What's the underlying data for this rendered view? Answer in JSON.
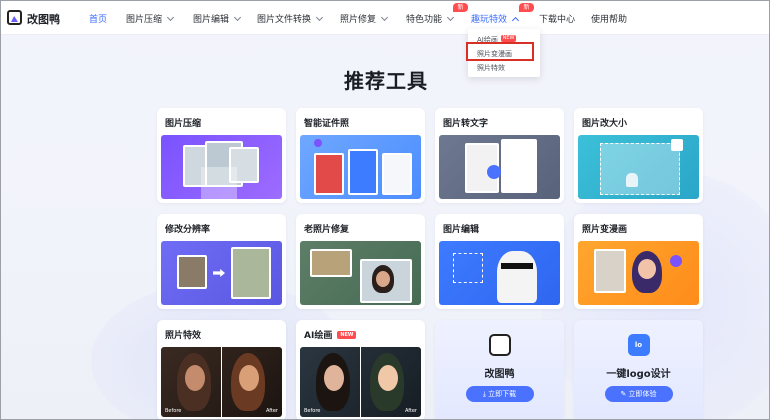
{
  "brand": {
    "name": "改图鸭"
  },
  "nav": {
    "items": [
      {
        "label": "首页",
        "active": true
      },
      {
        "label": "图片压缩",
        "dropdown": true
      },
      {
        "label": "图片编辑",
        "dropdown": true
      },
      {
        "label": "图片文件转换",
        "dropdown": true
      },
      {
        "label": "照片修复",
        "dropdown": true
      },
      {
        "label": "特色功能",
        "dropdown": true,
        "badge": "新"
      },
      {
        "label": "趣玩特效",
        "dropdown": true,
        "badge": "新",
        "open": true
      },
      {
        "label": "下载中心"
      },
      {
        "label": "使用帮助"
      }
    ]
  },
  "dropdown": {
    "items": [
      {
        "label": "AI绘画",
        "badge": "NEW"
      },
      {
        "label": "照片变漫画",
        "highlighted": true
      },
      {
        "label": "照片特效"
      }
    ]
  },
  "main": {
    "title": "推荐工具",
    "cards": [
      {
        "title": "图片压缩"
      },
      {
        "title": "智能证件照"
      },
      {
        "title": "图片转文字"
      },
      {
        "title": "图片改大小"
      },
      {
        "title": "修改分辨率"
      },
      {
        "title": "老照片修复"
      },
      {
        "title": "图片编辑"
      },
      {
        "title": "照片变漫画"
      },
      {
        "title": "照片特效",
        "before": "Before",
        "after": "After"
      },
      {
        "title": "AI绘画",
        "badge": "NEW",
        "before": "Before",
        "after": "After"
      }
    ],
    "promo": [
      {
        "name": "改图鸭",
        "button": "立即下载",
        "icon": "download-icon"
      },
      {
        "name": "一键logo设计",
        "button": "立即体验",
        "icon": "pencil-icon"
      }
    ]
  },
  "colors": {
    "accent": "#3b6cff",
    "hot": "#ff4d4f",
    "highlight_box": "#d93025"
  }
}
